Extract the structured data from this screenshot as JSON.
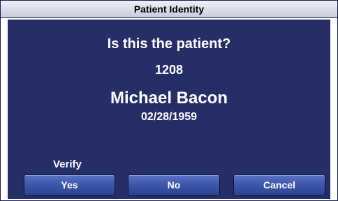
{
  "dialog": {
    "title": "Patient Identity",
    "question": "Is this the patient?",
    "patient": {
      "id": "1208",
      "name": "Michael Bacon",
      "dob": "02/28/1959"
    },
    "verify_label": "Verify",
    "buttons": {
      "yes": "Yes",
      "no": "No",
      "cancel": "Cancel"
    }
  },
  "colors": {
    "panel_background": "#262e66",
    "button_blue": "#3f58aa",
    "text": "#ffffff"
  }
}
